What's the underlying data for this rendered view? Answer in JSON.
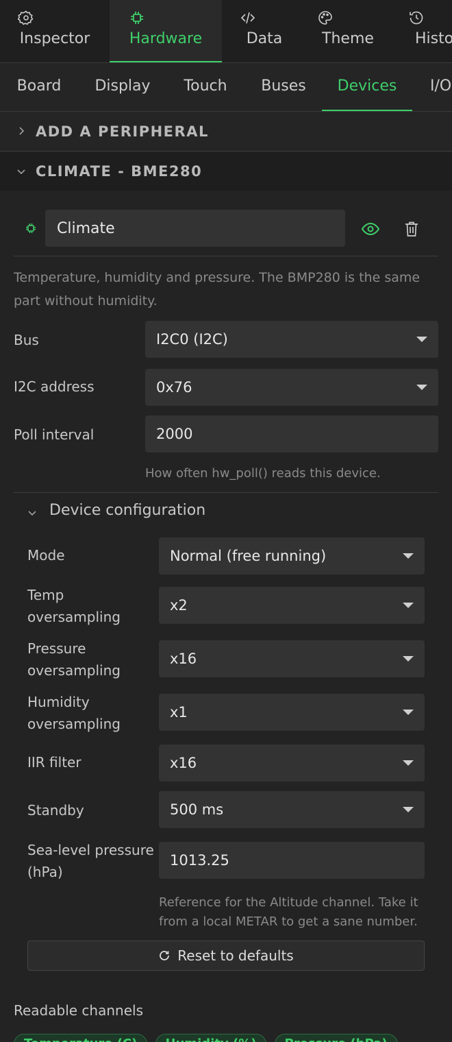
{
  "colors": {
    "accent": "#3fcf6a",
    "background": "#252526",
    "input": "#333333"
  },
  "top_tabs": [
    {
      "label": "Inspector",
      "icon": "gear-icon"
    },
    {
      "label": "Hardware",
      "icon": "chip-icon",
      "active": true
    },
    {
      "label": "Data",
      "icon": "code-icon"
    },
    {
      "label": "Theme",
      "icon": "palette-icon"
    },
    {
      "label": "Histo",
      "icon": "history-icon"
    }
  ],
  "sub_tabs": [
    {
      "label": "Board"
    },
    {
      "label": "Display"
    },
    {
      "label": "Touch"
    },
    {
      "label": "Buses"
    },
    {
      "label": "Devices",
      "active": true
    },
    {
      "label": "I/O"
    }
  ],
  "add_peripheral": {
    "title": "ADD A PERIPHERAL"
  },
  "device": {
    "section_title": "CLIMATE - BME280",
    "name": "Climate",
    "description": "Temperature, humidity and pressure. The BMP280 is the same part without humidity.",
    "fields": {
      "bus": {
        "label": "Bus",
        "value": "I2C0 (I2C)"
      },
      "address": {
        "label": "I2C address",
        "value": "0x76"
      },
      "poll": {
        "label": "Poll interval",
        "value": "2000",
        "hint": "How often hw_poll() reads this device."
      }
    },
    "config": {
      "title": "Device configuration",
      "mode": {
        "label": "Mode",
        "value": "Normal (free running)"
      },
      "temp_os": {
        "label_1": "Temp",
        "label_2": "oversampling",
        "value": "x2"
      },
      "pressure_os": {
        "label_1": "Pressure",
        "label_2": "oversampling",
        "value": "x16"
      },
      "humidity_os": {
        "label_1": "Humidity",
        "label_2": "oversampling",
        "value": "x1"
      },
      "iir": {
        "label": "IIR filter",
        "value": "x16"
      },
      "standby": {
        "label": "Standby",
        "value": "500 ms"
      },
      "sea_level": {
        "label_1": "Sea-level pressure",
        "label_2": "(hPa)",
        "value": "1013.25",
        "hint_1": "Reference for the Altitude channel. Take it",
        "hint_2": "from a local METAR to get a sane number."
      },
      "reset_label": "Reset to defaults"
    },
    "channels": {
      "title": "Readable channels",
      "items": [
        "Temperature (C)",
        "Humidity (%)",
        "Pressure (hPa)"
      ]
    }
  }
}
